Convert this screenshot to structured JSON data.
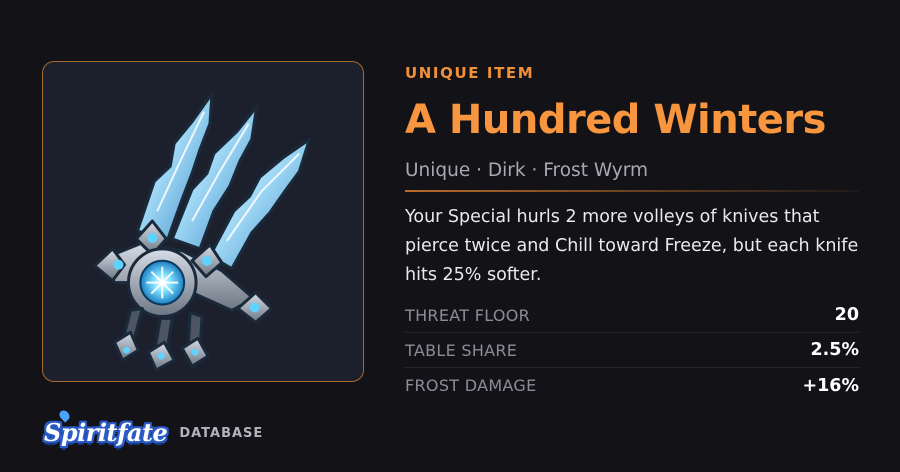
{
  "item": {
    "eyebrow": "UNIQUE ITEM",
    "name": "A Hundred Winters",
    "subtitle": "Unique · Dirk · Frost Wyrm",
    "description": "Your Special hurls 2 more volleys of knives that pierce twice and Chill toward Freeze, but each knife hits 25% softer.",
    "image_icon": "frost-dirk-icon",
    "stats": [
      {
        "label": "THREAT FLOOR",
        "value": "20"
      },
      {
        "label": "TABLE SHARE",
        "value": "2.5%"
      },
      {
        "label": "FROST DAMAGE",
        "value": "+16%"
      }
    ]
  },
  "brand": {
    "logo": "Spiritfate",
    "sub": "DATABASE"
  },
  "colors": {
    "background": "#131317",
    "panel": "#1c202c",
    "accent": "#f7963f",
    "frame_border": "#a86a2e",
    "ice": "#9fd8f5"
  }
}
